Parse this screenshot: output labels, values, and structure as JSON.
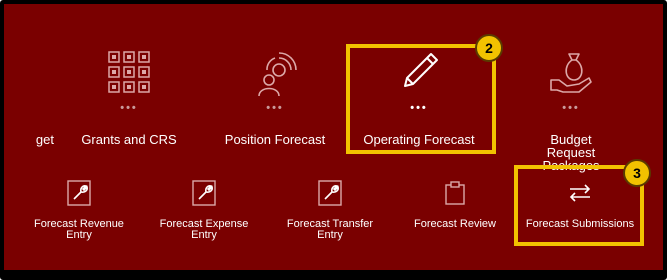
{
  "top_row": [
    {
      "label": "get",
      "icon": "partial-tile"
    },
    {
      "label": "Grants and CRS",
      "icon": "grid-icon"
    },
    {
      "label": "Position Forecast",
      "icon": "person-radar-icon"
    },
    {
      "label": "Operating Forecast",
      "icon": "pencil-icon"
    },
    {
      "label": "Budget Request Packages",
      "icon": "money-bag-hand-icon"
    }
  ],
  "bottom_row": [
    {
      "label": "Forecast Revenue Entry",
      "icon": "wrench-doc-icon"
    },
    {
      "label": "Forecast Expense Entry",
      "icon": "wrench-doc-icon"
    },
    {
      "label": "Forecast Transfer Entry",
      "icon": "wrench-doc-icon"
    },
    {
      "label": "Forecast Review",
      "icon": "clipboard-icon"
    },
    {
      "label": "Forecast Submissions",
      "icon": "swap-arrows-icon"
    }
  ],
  "dots": "•••",
  "callouts": [
    "2",
    "3"
  ],
  "colors": {
    "background": "#7a0000",
    "highlight": "#f2c200",
    "text": "#ffffff"
  }
}
